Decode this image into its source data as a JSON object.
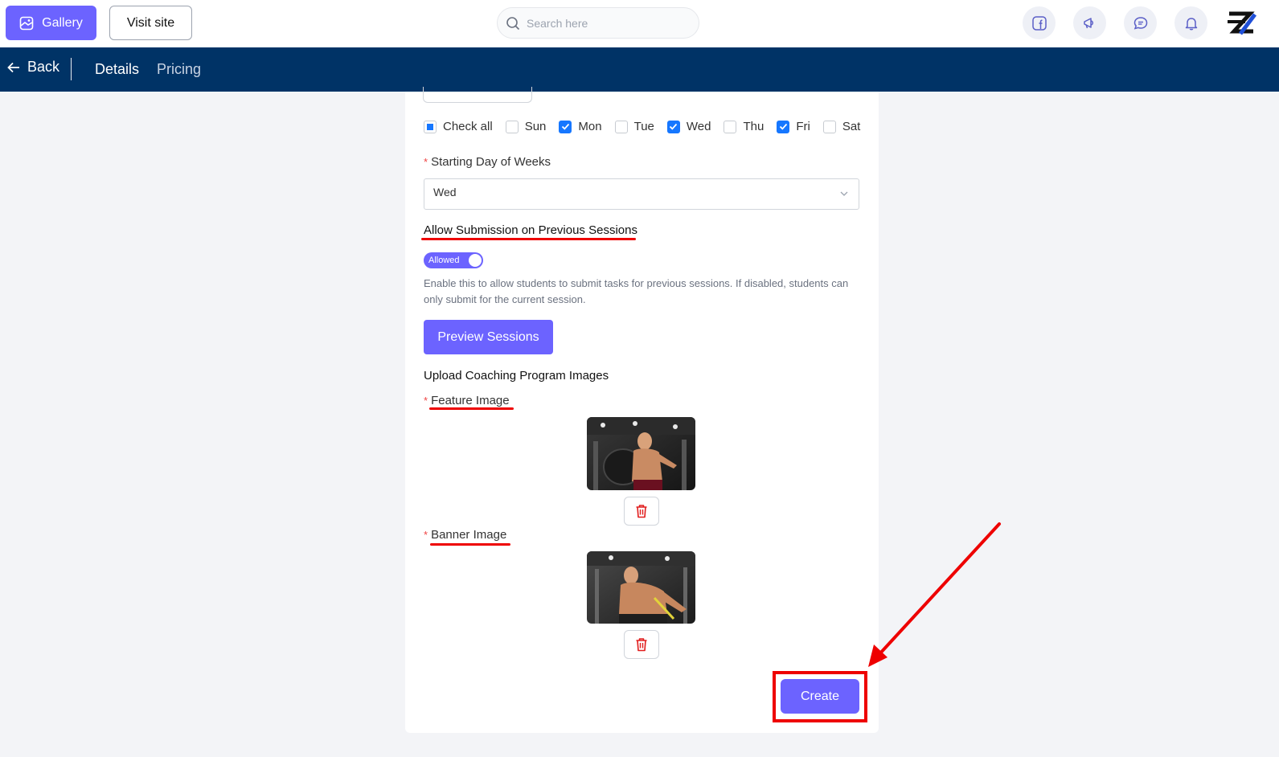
{
  "topbar": {
    "gallery_label": "Gallery",
    "visit_site_label": "Visit site",
    "search_placeholder": "Search here",
    "icons": [
      "facebook-icon",
      "megaphone-icon",
      "chat-icon",
      "bell-icon"
    ]
  },
  "navbar": {
    "back_label": "Back",
    "tabs": [
      {
        "label": "Details",
        "active": true
      },
      {
        "label": "Pricing",
        "active": false
      }
    ]
  },
  "form": {
    "days": [
      {
        "label": "Check all",
        "state": "indeterminate"
      },
      {
        "label": "Sun",
        "state": "unchecked"
      },
      {
        "label": "Mon",
        "state": "checked"
      },
      {
        "label": "Tue",
        "state": "unchecked"
      },
      {
        "label": "Wed",
        "state": "checked"
      },
      {
        "label": "Thu",
        "state": "unchecked"
      },
      {
        "label": "Fri",
        "state": "checked"
      },
      {
        "label": "Sat",
        "state": "unchecked"
      }
    ],
    "starting_day_label": "Starting Day of Weeks",
    "starting_day_value": "Wed",
    "allow_submission_label": "Allow Submission on Previous Sessions",
    "toggle_label": "Allowed",
    "help_text": "Enable this to allow students to submit tasks for previous sessions. If disabled, students can only submit for the current session.",
    "preview_button": "Preview Sessions",
    "upload_heading": "Upload Coaching Program Images",
    "feature_image_label": "Feature Image",
    "banner_image_label": "Banner Image",
    "create_button": "Create"
  },
  "colors": {
    "accent": "#6c63ff",
    "navy": "#003366",
    "annotation_red": "#ee0000",
    "checkbox_blue": "#1677ff"
  }
}
